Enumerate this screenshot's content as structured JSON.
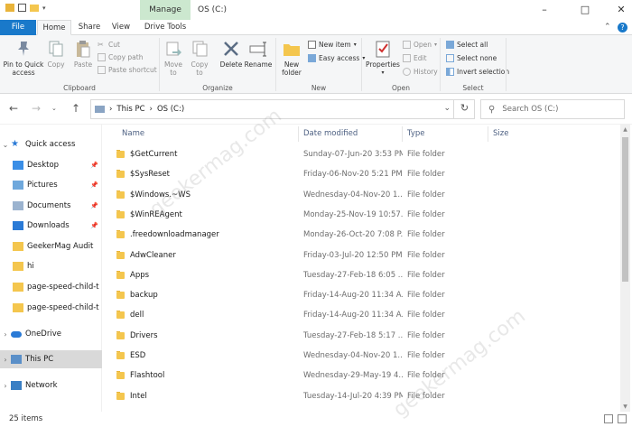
{
  "window": {
    "title": "OS (C:)",
    "context_tab": "Manage",
    "accent": "#1979ca",
    "manage_bg": "#cce8cf"
  },
  "ribbon_tabs": [
    "File",
    "Home",
    "Share",
    "View",
    "Drive Tools"
  ],
  "ribbon": {
    "clipboard": {
      "pin": "Pin to Quick\naccess",
      "copy": "Copy",
      "paste": "Paste",
      "cut": "Cut",
      "copy_path": "Copy path",
      "paste_shortcut": "Paste shortcut",
      "label": "Clipboard"
    },
    "organize": {
      "move_to": "Move\nto",
      "copy_to": "Copy\nto",
      "delete": "Delete",
      "rename": "Rename",
      "label": "Organize"
    },
    "new": {
      "new_folder": "New\nfolder",
      "new_item": "New item",
      "easy_access": "Easy access",
      "label": "New"
    },
    "open": {
      "properties": "Properties",
      "open": "Open",
      "edit": "Edit",
      "history": "History",
      "label": "Open"
    },
    "select": {
      "select_all": "Select all",
      "select_none": "Select none",
      "invert": "Invert selection",
      "label": "Select"
    }
  },
  "address": {
    "segments": [
      "This PC",
      "OS (C:)"
    ],
    "search_placeholder": "Search OS (C:)"
  },
  "nav_pane": {
    "quick_access": "Quick access",
    "items": [
      {
        "label": "Desktop",
        "pinned": true,
        "icon": "desktop-icon"
      },
      {
        "label": "Pictures",
        "pinned": true,
        "icon": "pictures-icon"
      },
      {
        "label": "Documents",
        "pinned": true,
        "icon": "documents-icon"
      },
      {
        "label": "Downloads",
        "pinned": true,
        "icon": "downloads-icon"
      },
      {
        "label": "GeekerMag Audit",
        "pinned": false,
        "icon": "folder-icon"
      },
      {
        "label": "hi",
        "pinned": false,
        "icon": "folder-icon"
      },
      {
        "label": "page-speed-child-t",
        "pinned": false,
        "icon": "folder-icon"
      },
      {
        "label": "page-speed-child-t",
        "pinned": false,
        "icon": "folder-icon"
      }
    ],
    "onedrive": "OneDrive",
    "this_pc": "This PC",
    "network": "Network"
  },
  "columns": {
    "name": "Name",
    "date": "Date modified",
    "type": "Type",
    "size": "Size"
  },
  "files": [
    {
      "name": "$GetCurrent",
      "date": "Sunday-07-Jun-20 3:53 PM",
      "type": "File folder"
    },
    {
      "name": "$SysReset",
      "date": "Friday-06-Nov-20 5:21 PM",
      "type": "File folder"
    },
    {
      "name": "$Windows.~WS",
      "date": "Wednesday-04-Nov-20 1...",
      "type": "File folder"
    },
    {
      "name": "$WinREAgent",
      "date": "Monday-25-Nov-19 10:57...",
      "type": "File folder"
    },
    {
      "name": ".freedownloadmanager",
      "date": "Monday-26-Oct-20 7:08 P...",
      "type": "File folder"
    },
    {
      "name": "AdwCleaner",
      "date": "Friday-03-Jul-20 12:50 PM",
      "type": "File folder"
    },
    {
      "name": "Apps",
      "date": "Tuesday-27-Feb-18 6:05 ...",
      "type": "File folder"
    },
    {
      "name": "backup",
      "date": "Friday-14-Aug-20 11:34 A...",
      "type": "File folder"
    },
    {
      "name": "dell",
      "date": "Friday-14-Aug-20 11:34 A...",
      "type": "File folder"
    },
    {
      "name": "Drivers",
      "date": "Tuesday-27-Feb-18 5:17 ...",
      "type": "File folder"
    },
    {
      "name": "ESD",
      "date": "Wednesday-04-Nov-20 1...",
      "type": "File folder"
    },
    {
      "name": "Flashtool",
      "date": "Wednesday-29-May-19 4...",
      "type": "File folder"
    },
    {
      "name": "Intel",
      "date": "Tuesday-14-Jul-20 4:39 PM",
      "type": "File folder"
    }
  ],
  "status": {
    "item_count": "25 items"
  },
  "watermark": "geekermag.com"
}
